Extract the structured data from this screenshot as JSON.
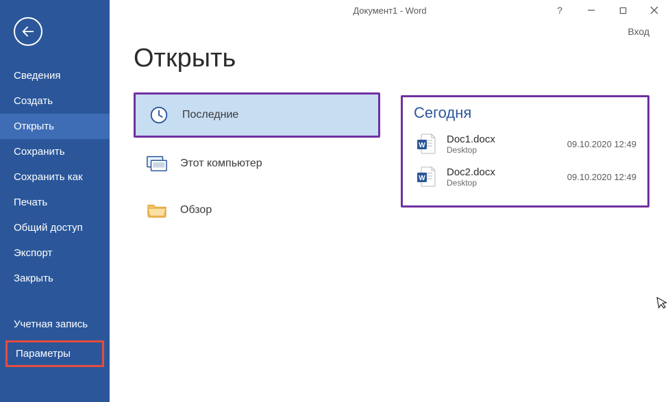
{
  "titlebar": {
    "title": "Документ1 - Word",
    "help": "?",
    "signin": "Вход"
  },
  "sidebar": {
    "items": [
      {
        "label": "Сведения"
      },
      {
        "label": "Создать"
      },
      {
        "label": "Открыть",
        "selected": true
      },
      {
        "label": "Сохранить"
      },
      {
        "label": "Сохранить как"
      },
      {
        "label": "Печать"
      },
      {
        "label": "Общий доступ"
      },
      {
        "label": "Экспорт"
      },
      {
        "label": "Закрыть"
      }
    ],
    "footer": [
      {
        "label": "Учетная запись"
      },
      {
        "label": "Параметры",
        "boxed": true
      }
    ]
  },
  "page": {
    "title": "Открыть",
    "sources": {
      "recent": "Последние",
      "this_pc": "Этот компьютер",
      "browse": "Обзор"
    }
  },
  "files": {
    "section": "Сегодня",
    "list": [
      {
        "name": "Doc1.docx",
        "location": "Desktop",
        "time": "09.10.2020 12:49"
      },
      {
        "name": "Doc2.docx",
        "location": "Desktop",
        "time": "09.10.2020 12:49"
      }
    ]
  }
}
